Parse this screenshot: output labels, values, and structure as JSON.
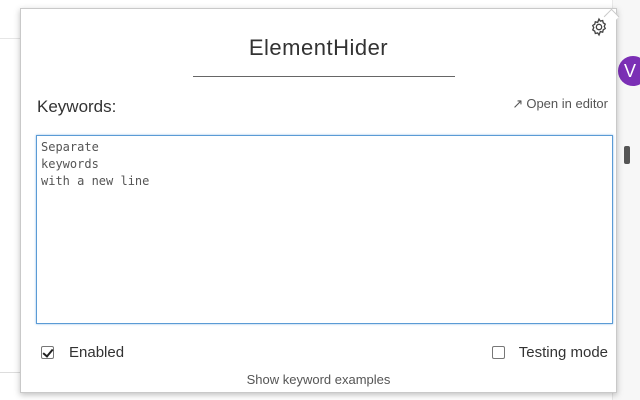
{
  "app": {
    "title": "ElementHider",
    "settings_icon": "gear-icon"
  },
  "background": {
    "avatar_letter": "V",
    "avatar_color": "#7b2fb5"
  },
  "keywords": {
    "label": "Keywords:",
    "open_editor_label": "Open in editor",
    "open_editor_icon": "arrow-up-right-icon",
    "textarea_value": "",
    "textarea_placeholder": "Separate\nkeywords\nwith a new line"
  },
  "options": {
    "enabled_label": "Enabled",
    "enabled_checked": true,
    "testing_label": "Testing mode",
    "testing_checked": false
  },
  "footer": {
    "show_examples_label": "Show keyword examples"
  },
  "colors": {
    "textarea_focus_border": "#5b9bd5",
    "text": "#333333"
  }
}
